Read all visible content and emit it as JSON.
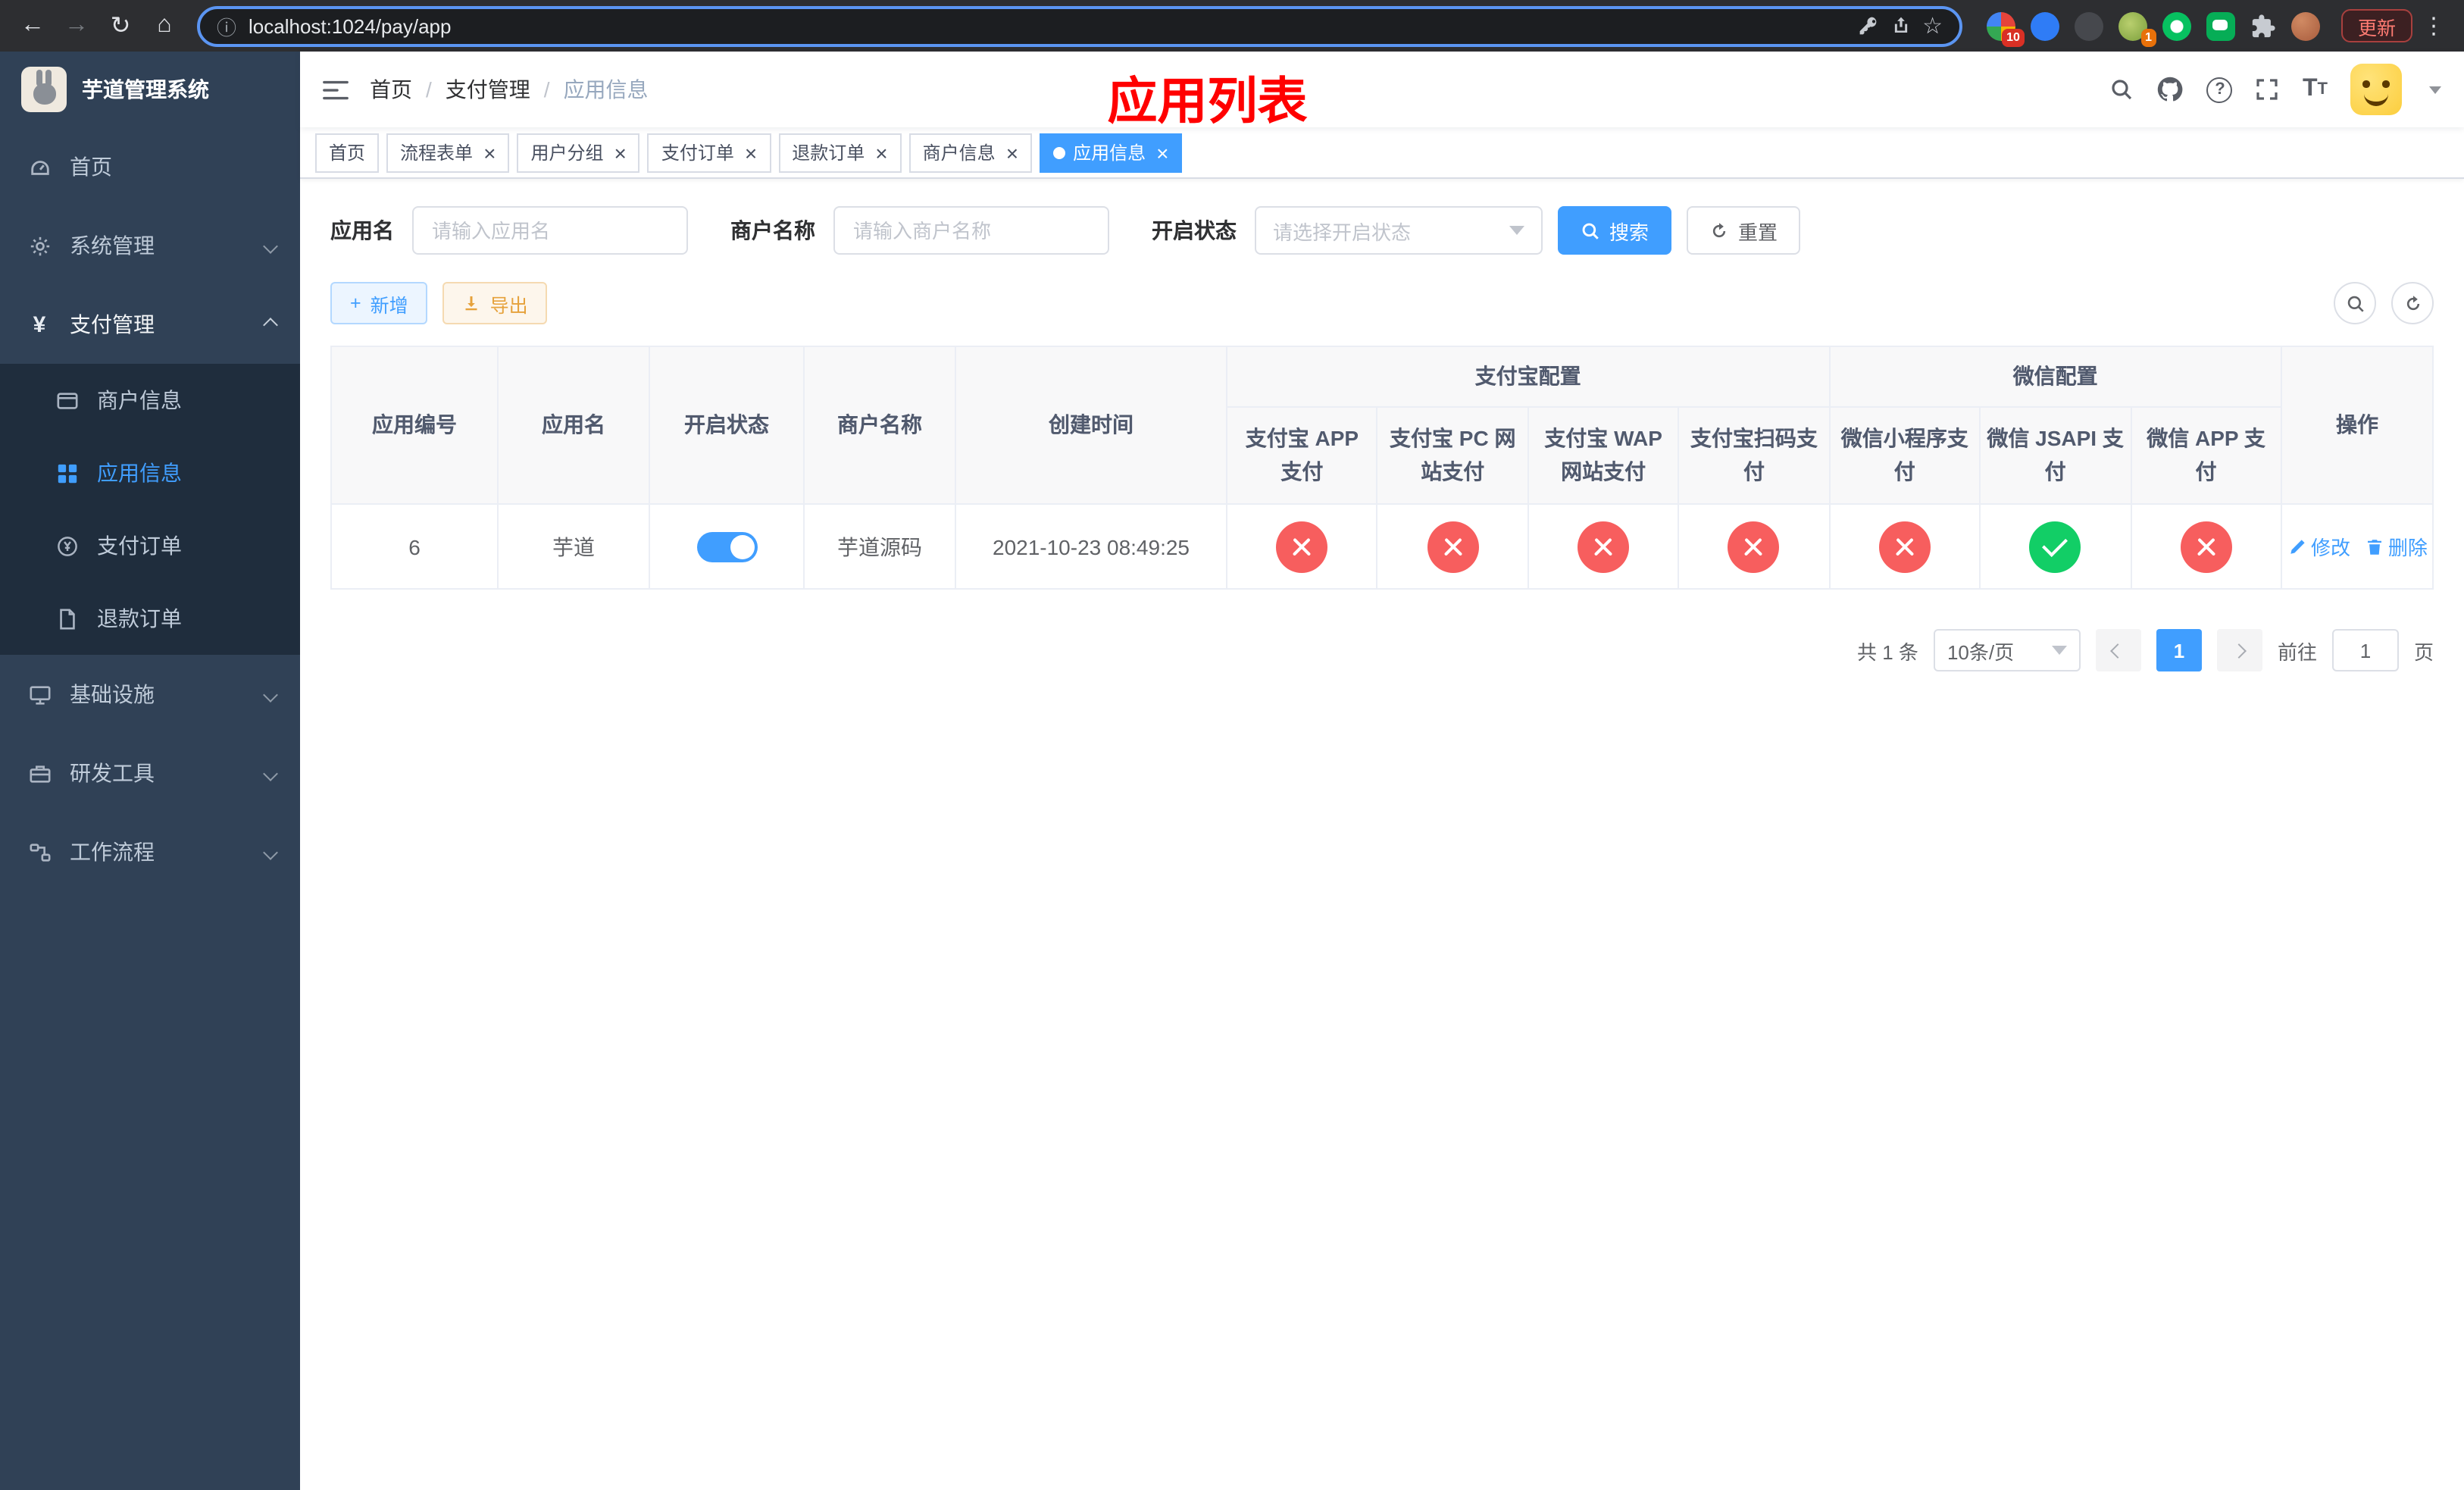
{
  "browser": {
    "url": "localhost:1024/pay/app",
    "update_label": "更新",
    "ext1_badge": "10",
    "ext4_badge": "1"
  },
  "icons": {
    "back": "←",
    "forward": "→",
    "reload": "↻",
    "home": "⌂",
    "info": "ⓘ",
    "star": "☆",
    "more": "⋮",
    "plus": "+",
    "close": "×"
  },
  "overlay": {
    "title": "应用列表"
  },
  "sidebar": {
    "logo_title": "芋道管理系统",
    "items": [
      {
        "label": "首页"
      },
      {
        "label": "系统管理"
      },
      {
        "label": "支付管理",
        "children": [
          {
            "label": "商户信息"
          },
          {
            "label": "应用信息"
          },
          {
            "label": "支付订单"
          },
          {
            "label": "退款订单"
          }
        ]
      },
      {
        "label": "基础设施"
      },
      {
        "label": "研发工具"
      },
      {
        "label": "工作流程"
      }
    ]
  },
  "breadcrumb": {
    "separator": "/",
    "items": [
      "首页",
      "支付管理",
      "应用信息"
    ]
  },
  "tabs": [
    {
      "label": "首页"
    },
    {
      "label": "流程表单"
    },
    {
      "label": "用户分组"
    },
    {
      "label": "支付订单"
    },
    {
      "label": "退款订单"
    },
    {
      "label": "商户信息"
    },
    {
      "label": "应用信息"
    }
  ],
  "filters": {
    "app_name_label": "应用名",
    "app_name_placeholder": "请输入应用名",
    "merchant_label": "商户名称",
    "merchant_placeholder": "请输入商户名称",
    "status_label": "开启状态",
    "status_placeholder": "请选择开启状态",
    "search_label": "搜索",
    "reset_label": "重置"
  },
  "toolbar": {
    "add_label": "新增",
    "export_label": "导出"
  },
  "table": {
    "headers": {
      "app_id": "应用编号",
      "app_name": "应用名",
      "status": "开启状态",
      "merchant": "商户名称",
      "create_time": "创建时间",
      "alipay_group": "支付宝配置",
      "wechat_group": "微信配置",
      "alipay_app": "支付宝 APP 支付",
      "alipay_pc": "支付宝 PC 网站支付",
      "alipay_wap": "支付宝 WAP 网站支付",
      "alipay_qr": "支付宝扫码支付",
      "wx_lite": "微信小程序支付",
      "wx_jsapi": "微信 JSAPI 支付",
      "wx_app": "微信 APP 支付",
      "actions": "操作"
    },
    "rows": [
      {
        "app_id": "6",
        "app_name": "芋道",
        "status_on": true,
        "merchant": "芋道源码",
        "create_time": "2021-10-23 08:49:25",
        "channels": [
          {
            "name": "alipay_app",
            "enabled": false
          },
          {
            "name": "alipay_pc",
            "enabled": false
          },
          {
            "name": "alipay_wap",
            "enabled": false
          },
          {
            "name": "alipay_qr",
            "enabled": false
          },
          {
            "name": "wx_lite",
            "enabled": false
          },
          {
            "name": "wx_jsapi",
            "enabled": true
          },
          {
            "name": "wx_app",
            "enabled": false
          }
        ],
        "edit_label": "修改",
        "delete_label": "删除"
      }
    ]
  },
  "pagination": {
    "total_text": "共 1 条",
    "page_size_text": "10条/页",
    "current_page": "1",
    "goto_label": "前往",
    "goto_value": "1",
    "goto_suffix": "页"
  }
}
